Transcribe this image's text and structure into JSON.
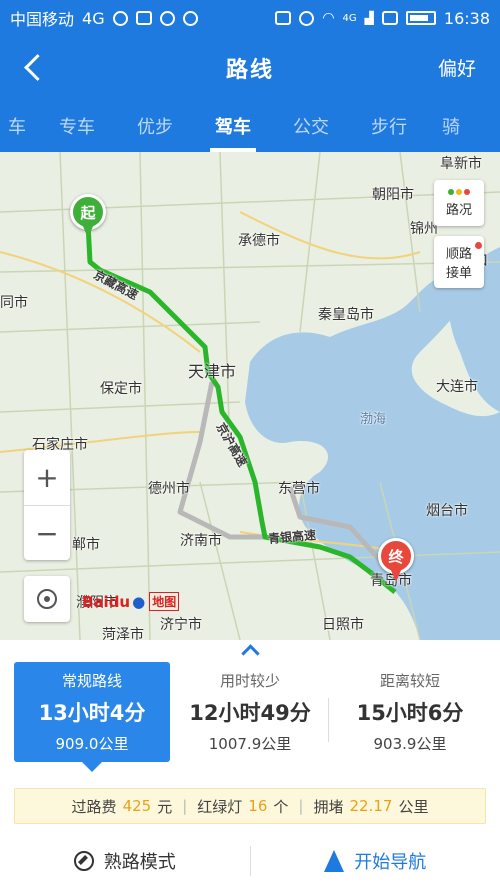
{
  "status_bar": {
    "carrier": "中国移动",
    "network": "4G",
    "signal_label": "4G",
    "time": "16:38"
  },
  "header": {
    "title": "路线",
    "right_label": "偏好"
  },
  "tabs": [
    {
      "label": "车"
    },
    {
      "label": "专车"
    },
    {
      "label": "优步"
    },
    {
      "label": "驾车",
      "active": true
    },
    {
      "label": "公交"
    },
    {
      "label": "步行"
    },
    {
      "label": "骑"
    }
  ],
  "map": {
    "start_marker": "起",
    "end_marker": "终",
    "traffic_button": "路况",
    "carpool_button": {
      "line1": "顺路",
      "line2": "接单"
    },
    "zoom_in": "+",
    "zoom_out": "−",
    "logo": {
      "baidu": "Baidu",
      "map": "地图"
    },
    "places": [
      {
        "name": "阜新市"
      },
      {
        "name": "朝阳市"
      },
      {
        "name": "锦州"
      },
      {
        "name": "承德市"
      },
      {
        "name": "营口"
      },
      {
        "name": "同市"
      },
      {
        "name": "秦皇岛市"
      },
      {
        "name": "天津市"
      },
      {
        "name": "大连市"
      },
      {
        "name": "保定市"
      },
      {
        "name": "渤海"
      },
      {
        "name": "石家庄市"
      },
      {
        "name": "德州市"
      },
      {
        "name": "东营市"
      },
      {
        "name": "烟台市"
      },
      {
        "name": "济南市"
      },
      {
        "name": "郸市"
      },
      {
        "name": "青岛市"
      },
      {
        "name": "濮阳市"
      },
      {
        "name": "济宁市"
      },
      {
        "name": "日照市"
      },
      {
        "name": "菏泽市"
      }
    ],
    "roads": [
      {
        "name": "京藏高速"
      },
      {
        "name": "京沪高速"
      },
      {
        "name": "青银高速"
      }
    ],
    "colors": {
      "route": "#2bb52b",
      "alt_route": "#b8b8b8",
      "start": "#3eb03a",
      "end": "#e8483c",
      "sea": "#a7cbe6"
    }
  },
  "route_options": [
    {
      "label": "常规路线",
      "time": "13小时4分",
      "distance": "909.0公里",
      "selected": true
    },
    {
      "label": "用时较少",
      "time": "12小时49分",
      "distance": "1007.9公里"
    },
    {
      "label": "距离较短",
      "time": "15小时6分",
      "distance": "903.9公里"
    }
  ],
  "route_info": {
    "toll_label": "过路费",
    "toll_value": "425",
    "toll_unit": "元",
    "lights_label": "红绿灯",
    "lights_value": "16",
    "lights_unit": "个",
    "jam_label": "拥堵",
    "jam_value": "22.17",
    "jam_unit": "公里"
  },
  "actions": {
    "familiar": "熟路模式",
    "start": "开始导航"
  }
}
